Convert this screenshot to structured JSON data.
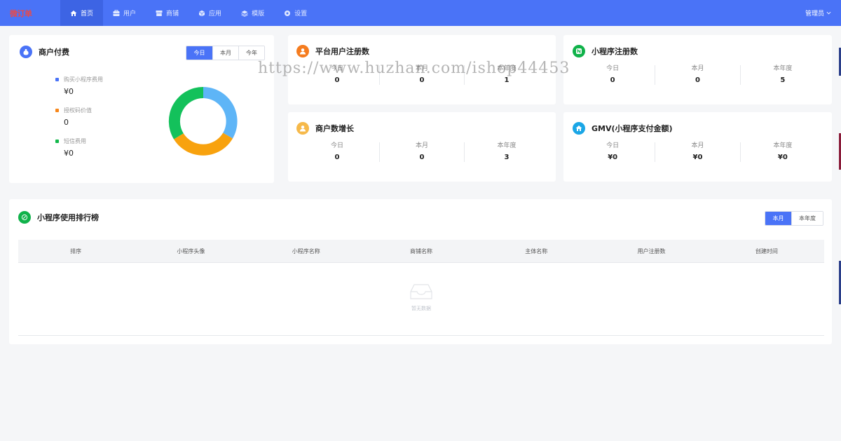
{
  "nav": {
    "logo_text": "微订单",
    "items": [
      {
        "label": "首页",
        "icon": "home-icon",
        "active": true
      },
      {
        "label": "用户",
        "icon": "user-folder-icon",
        "active": false
      },
      {
        "label": "商铺",
        "icon": "shop-icon",
        "active": false
      },
      {
        "label": "应用",
        "icon": "cube-icon",
        "active": false
      },
      {
        "label": "模版",
        "icon": "layers-icon",
        "active": false
      },
      {
        "label": "设置",
        "icon": "gear-icon",
        "active": false
      }
    ],
    "user_label": "管理员"
  },
  "merchant_payment": {
    "title": "商户付费",
    "tabs": [
      "今日",
      "本月",
      "今年"
    ],
    "active_tab": 0,
    "legend": [
      {
        "label": "购买小程序费用",
        "value": "¥0",
        "color": "#4a73f7"
      },
      {
        "label": "授权码价值",
        "value": "0",
        "color": "#f7871b"
      },
      {
        "label": "短信费用",
        "value": "¥0",
        "color": "#12b84a"
      }
    ],
    "donut_colors": [
      "#5eb5f7",
      "#f8a20e",
      "#13c15b"
    ]
  },
  "platform_users": {
    "title": "平台用户注册数",
    "icon_color": "#f57c1f",
    "stats": [
      {
        "label": "今日",
        "value": "0"
      },
      {
        "label": "本月",
        "value": "0"
      },
      {
        "label": "本年度",
        "value": "1"
      }
    ]
  },
  "mini_program_reg": {
    "title": "小程序注册数",
    "icon_color": "#10b24a",
    "stats": [
      {
        "label": "今日",
        "value": "0"
      },
      {
        "label": "本月",
        "value": "0"
      },
      {
        "label": "本年度",
        "value": "5"
      }
    ]
  },
  "merchant_growth": {
    "title": "商户数增长",
    "icon_color": "#f6b94a",
    "stats": [
      {
        "label": "今日",
        "value": "0"
      },
      {
        "label": "本月",
        "value": "0"
      },
      {
        "label": "本年度",
        "value": "3"
      }
    ]
  },
  "gmv": {
    "title": "GMV(小程序支付金额)",
    "icon_color": "#1aa6e6",
    "stats": [
      {
        "label": "今日",
        "value": "¥0"
      },
      {
        "label": "本月",
        "value": "¥0"
      },
      {
        "label": "本年度",
        "value": "¥0"
      }
    ]
  },
  "ranking": {
    "title": "小程序使用排行榜",
    "icon_color": "#10b24a",
    "tabs": [
      "本月",
      "本年度"
    ],
    "active_tab": 0,
    "columns": [
      "排序",
      "小程序头像",
      "小程序名称",
      "商铺名称",
      "主体名称",
      "用户注册数",
      "创建时间"
    ],
    "empty_text": "暂无数据"
  },
  "watermark": "https://www.huzhan.com/ishop44453",
  "accent_color": "#4a73f7"
}
